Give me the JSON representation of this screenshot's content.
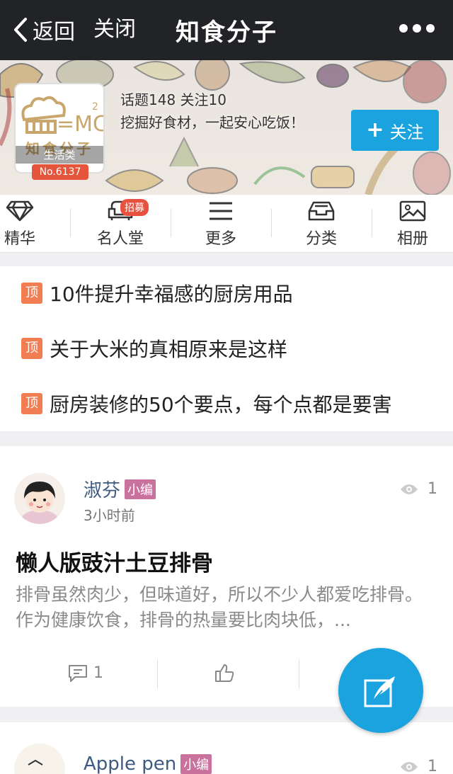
{
  "nav": {
    "back_label": "返回",
    "close_label": "关闭",
    "title": "知食分子"
  },
  "group": {
    "logo_text": "知食分子",
    "logo_mark": "=MC",
    "logo_superscript": "2",
    "category": "生活类",
    "rank": "No.6137",
    "stats": "话题148  关注10",
    "description": "挖掘好食材，一起安心吃饭！",
    "follow_label": "关注"
  },
  "tabs": [
    {
      "label": "精华",
      "icon": "diamond-icon"
    },
    {
      "label": "名人堂",
      "icon": "sofa-icon",
      "badge": "招募"
    },
    {
      "label": "更多",
      "icon": "menu-icon"
    },
    {
      "label": "分类",
      "icon": "inbox-icon"
    },
    {
      "label": "相册",
      "icon": "photo-icon"
    }
  ],
  "pinned": {
    "tag": "顶",
    "items": [
      "10件提升幸福感的厨房用品",
      "关于大米的真相原来是这样",
      "厨房装修的50个要点，每个点都是要害"
    ]
  },
  "posts": [
    {
      "author": "淑芬",
      "role": "小编",
      "time": "3小时前",
      "views": "1",
      "title": "懒人版豉汁土豆排骨",
      "summary": "排骨虽然肉少，但味道好，所以不少人都爱吃排骨。作为健康饮食，排骨的热量要比肉块低，...",
      "comments": "1"
    },
    {
      "author": "Apple pen",
      "role": "小编",
      "views": "1"
    }
  ],
  "colors": {
    "accent": "#1aa3de",
    "pin_tag": "#f17d53",
    "role_tag": "#c9729d",
    "badge": "#e9513f",
    "rank": "#e4553b"
  }
}
